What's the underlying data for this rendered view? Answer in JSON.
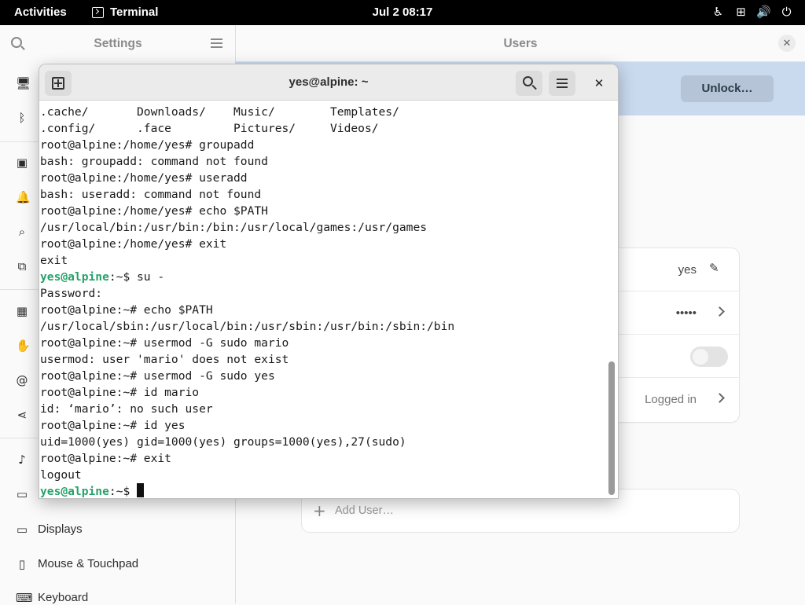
{
  "topbar": {
    "activities": "Activities",
    "app_name": "Terminal",
    "clock": "Jul 2  08:17",
    "tray_icons": [
      "accessibility-icon",
      "network-icon",
      "volume-icon",
      "power-icon"
    ]
  },
  "settings": {
    "sidebar_title": "Settings",
    "content_title": "Users",
    "unlock_label": "Unlock…",
    "sidebar_items": [
      {
        "label": "Displays",
        "icon": "display-icon"
      },
      {
        "label": "Mouse & Touchpad",
        "icon": "mouse-icon"
      },
      {
        "label": "Keyboard",
        "icon": "keyboard-icon"
      }
    ],
    "user": {
      "username": "yes",
      "password_mask": "•••••",
      "activity": "Logged in",
      "add_user_label": "Add User…"
    }
  },
  "terminal": {
    "title": "yes@alpine: ~",
    "lines": [
      ".cache/       Downloads/    Music/        Templates/",
      ".config/      .face         Pictures/     Videos/",
      "root@alpine:/home/yes# groupadd",
      "bash: groupadd: command not found",
      "root@alpine:/home/yes# useradd",
      "bash: useradd: command not found",
      "root@alpine:/home/yes# echo $PATH",
      "/usr/local/bin:/usr/bin:/bin:/usr/local/games:/usr/games",
      "root@alpine:/home/yes# exit",
      "exit",
      {
        "user": "yes@alpine",
        "rest": ":~$ su -"
      },
      "Password:",
      "root@alpine:~# echo $PATH",
      "/usr/local/sbin:/usr/local/bin:/usr/sbin:/usr/bin:/sbin:/bin",
      "root@alpine:~# usermod -G sudo mario",
      "usermod: user 'mario' does not exist",
      "root@alpine:~# usermod -G sudo yes",
      "root@alpine:~# id mario",
      "id: ‘mario’: no such user",
      "root@alpine:~# id yes",
      "uid=1000(yes) gid=1000(yes) groups=1000(yes),27(sudo)",
      "root@alpine:~# exit",
      "logout",
      {
        "user": "yes@alpine",
        "rest": ":~$ ",
        "cursor": true
      }
    ]
  }
}
